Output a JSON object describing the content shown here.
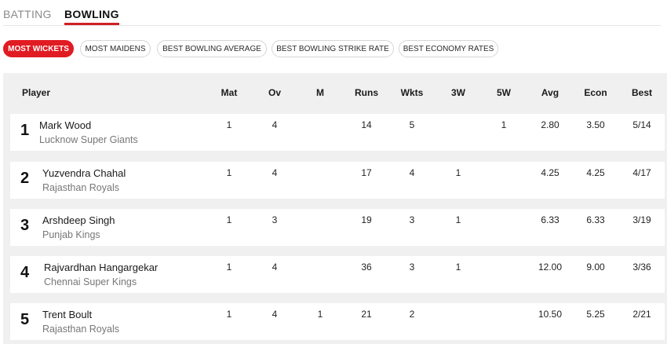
{
  "tabs": {
    "batting": "BATTING",
    "bowling": "BOWLING"
  },
  "filters": [
    {
      "label": "MOST WICKETS",
      "active": true
    },
    {
      "label": "MOST MAIDENS",
      "active": false
    },
    {
      "label": "BEST BOWLING AVERAGE",
      "active": false
    },
    {
      "label": "BEST BOWLING STRIKE RATE",
      "active": false
    },
    {
      "label": "BEST ECONOMY RATES",
      "active": false
    }
  ],
  "table": {
    "headers": {
      "player": "Player",
      "mat": "Mat",
      "ov": "Ov",
      "m": "M",
      "runs": "Runs",
      "wkts": "Wkts",
      "w3": "3W",
      "w5": "5W",
      "avg": "Avg",
      "econ": "Econ",
      "best": "Best"
    },
    "rows": [
      {
        "rank": "1",
        "name": "Mark Wood",
        "team": "Lucknow Super Giants",
        "mat": "1",
        "ov": "4",
        "m": "",
        "runs": "14",
        "wkts": "5",
        "w3": "",
        "w5": "1",
        "avg": "2.80",
        "econ": "3.50",
        "best": "5/14"
      },
      {
        "rank": "2",
        "name": "Yuzvendra Chahal",
        "team": "Rajasthan Royals",
        "mat": "1",
        "ov": "4",
        "m": "",
        "runs": "17",
        "wkts": "4",
        "w3": "1",
        "w5": "",
        "avg": "4.25",
        "econ": "4.25",
        "best": "4/17"
      },
      {
        "rank": "3",
        "name": "Arshdeep Singh",
        "team": "Punjab Kings",
        "mat": "1",
        "ov": "3",
        "m": "",
        "runs": "19",
        "wkts": "3",
        "w3": "1",
        "w5": "",
        "avg": "6.33",
        "econ": "6.33",
        "best": "3/19"
      },
      {
        "rank": "4",
        "name": "Rajvardhan Hangargekar",
        "team": "Chennai Super Kings",
        "mat": "1",
        "ov": "4",
        "m": "",
        "runs": "36",
        "wkts": "3",
        "w3": "1",
        "w5": "",
        "avg": "12.00",
        "econ": "9.00",
        "best": "3/36"
      },
      {
        "rank": "5",
        "name": "Trent Boult",
        "team": "Rajasthan Royals",
        "mat": "1",
        "ov": "4",
        "m": "1",
        "runs": "21",
        "wkts": "2",
        "w3": "",
        "w5": "",
        "avg": "10.50",
        "econ": "5.25",
        "best": "2/21"
      }
    ]
  }
}
